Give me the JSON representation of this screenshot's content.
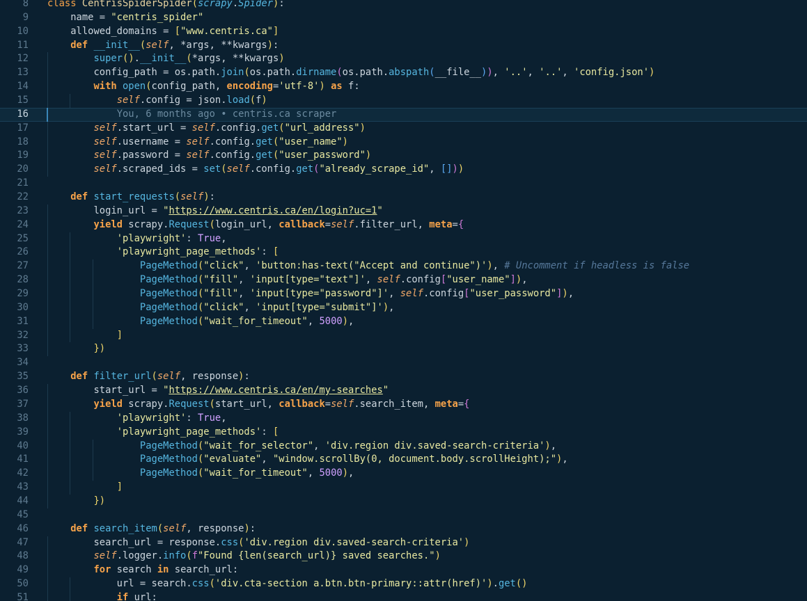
{
  "editor": {
    "active_line": "16",
    "blame": "You, 6 months ago • centris.ca scraper",
    "lines": [
      {
        "num": "8",
        "text": "class CentrisSpiderSpider(scrapy.Spider):"
      },
      {
        "num": "9",
        "text": "    name = \"centris_spider\""
      },
      {
        "num": "10",
        "text": "    allowed_domains = [\"www.centris.ca\"]"
      },
      {
        "num": "11",
        "text": "    def __init__(self, *args, **kwargs):"
      },
      {
        "num": "12",
        "text": "        super().__init__(*args, **kwargs)"
      },
      {
        "num": "13",
        "text": "        config_path = os.path.join(os.path.dirname(os.path.abspath(__file__)), '..', '..', 'config.json')"
      },
      {
        "num": "14",
        "text": "        with open(config_path, encoding='utf-8') as f:"
      },
      {
        "num": "15",
        "text": "            self.config = json.load(f)"
      },
      {
        "num": "16",
        "text": ""
      },
      {
        "num": "17",
        "text": "        self.start_url = self.config.get(\"url_address\")"
      },
      {
        "num": "18",
        "text": "        self.username = self.config.get(\"user_name\")"
      },
      {
        "num": "19",
        "text": "        self.password = self.config.get(\"user_password\")"
      },
      {
        "num": "20",
        "text": "        self.scraped_ids = set(self.config.get(\"already_scrape_id\", []))"
      },
      {
        "num": "21",
        "text": ""
      },
      {
        "num": "22",
        "text": "    def start_requests(self):"
      },
      {
        "num": "23",
        "text": "        login_url = \"https://www.centris.ca/en/login?uc=1\""
      },
      {
        "num": "24",
        "text": "        yield scrapy.Request(login_url, callback=self.filter_url, meta={"
      },
      {
        "num": "25",
        "text": "            'playwright': True,"
      },
      {
        "num": "26",
        "text": "            'playwright_page_methods': ["
      },
      {
        "num": "27",
        "text": "                PageMethod(\"click\", 'button:has-text(\"Accept and continue\")'), # Uncomment if headless is false"
      },
      {
        "num": "28",
        "text": "                PageMethod(\"fill\", 'input[type=\"text\"]', self.config[\"user_name\"]),"
      },
      {
        "num": "29",
        "text": "                PageMethod(\"fill\", 'input[type=\"password\"]', self.config[\"user_password\"]),"
      },
      {
        "num": "30",
        "text": "                PageMethod(\"click\", 'input[type=\"submit\"]'),"
      },
      {
        "num": "31",
        "text": "                PageMethod(\"wait_for_timeout\", 5000),"
      },
      {
        "num": "32",
        "text": "            ]"
      },
      {
        "num": "33",
        "text": "        })"
      },
      {
        "num": "34",
        "text": ""
      },
      {
        "num": "35",
        "text": "    def filter_url(self, response):"
      },
      {
        "num": "36",
        "text": "        start_url = \"https://www.centris.ca/en/my-searches\""
      },
      {
        "num": "37",
        "text": "        yield scrapy.Request(start_url, callback=self.search_item, meta={"
      },
      {
        "num": "38",
        "text": "            'playwright': True,"
      },
      {
        "num": "39",
        "text": "            'playwright_page_methods': ["
      },
      {
        "num": "40",
        "text": "                PageMethod(\"wait_for_selector\", 'div.region div.saved-search-criteria'),"
      },
      {
        "num": "41",
        "text": "                PageMethod(\"evaluate\", \"window.scrollBy(0, document.body.scrollHeight);\"),"
      },
      {
        "num": "42",
        "text": "                PageMethod(\"wait_for_timeout\", 5000),"
      },
      {
        "num": "43",
        "text": "            ]"
      },
      {
        "num": "44",
        "text": "        })"
      },
      {
        "num": "45",
        "text": ""
      },
      {
        "num": "46",
        "text": "    def search_item(self, response):"
      },
      {
        "num": "47",
        "text": "        search_url = response.css('div.region div.saved-search-criteria')"
      },
      {
        "num": "48",
        "text": "        self.logger.info(f\"Found {len(search_url)} saved searches.\")"
      },
      {
        "num": "49",
        "text": "        for search in search_url:"
      },
      {
        "num": "50",
        "text": "            url = search.css('div.cta-section a.btn.btn-primary::attr(href)').get()"
      },
      {
        "num": "51",
        "text": "            if url:"
      }
    ]
  }
}
